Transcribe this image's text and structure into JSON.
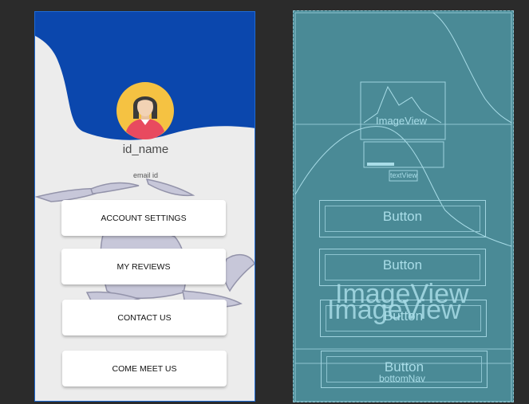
{
  "design": {
    "id_name": "id_name",
    "email_id": "email id",
    "buttons": [
      "ACCOUNT SETTINGS",
      "MY REVIEWS",
      "CONTACT US",
      "COME MEET US"
    ],
    "colors": {
      "header": "#0b47ad",
      "avatar_bg": "#f5c242"
    }
  },
  "blueprint": {
    "imageview_small": "ImageView",
    "textview": "textView",
    "imageview_large_1": "ImageView",
    "imageview_large_2": "ImageView",
    "bottom_nav": "bottomNav",
    "buttons": [
      "Button",
      "Button",
      "Button",
      "Button"
    ]
  }
}
